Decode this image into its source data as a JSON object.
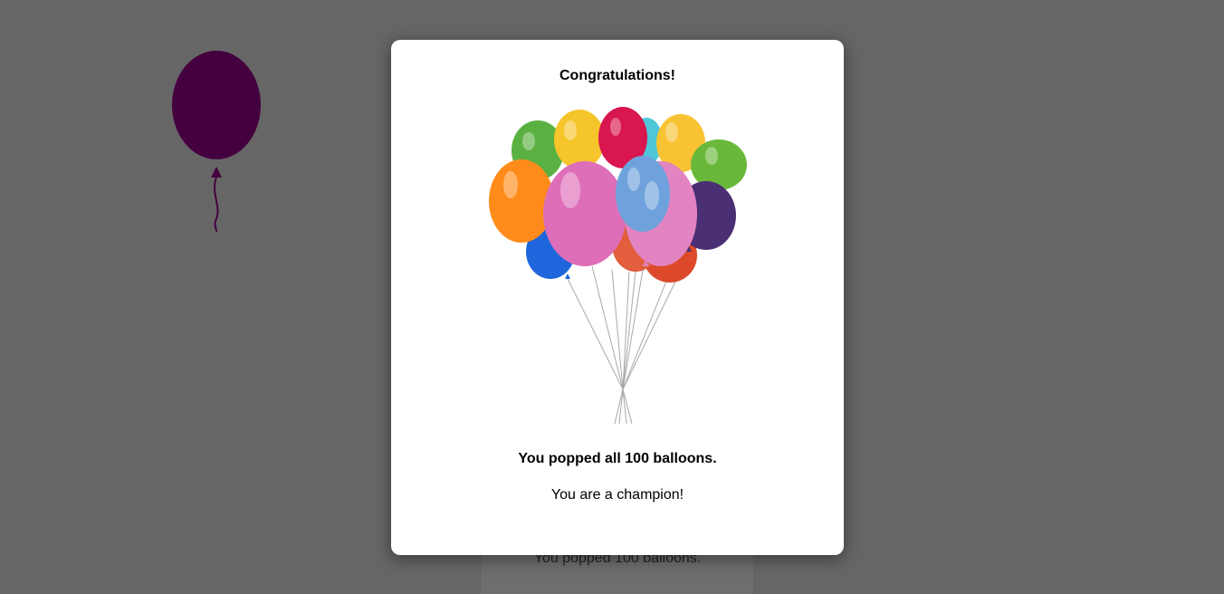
{
  "game": {
    "score_text": "You popped 100 balloons."
  },
  "modal": {
    "title": "Congratulations!",
    "message": "You popped all 100 balloons.",
    "submessage": "You are a champion!"
  },
  "colors": {
    "overlay": "#666666",
    "background_balloon": "#45003f",
    "modal_background": "#ffffff"
  }
}
